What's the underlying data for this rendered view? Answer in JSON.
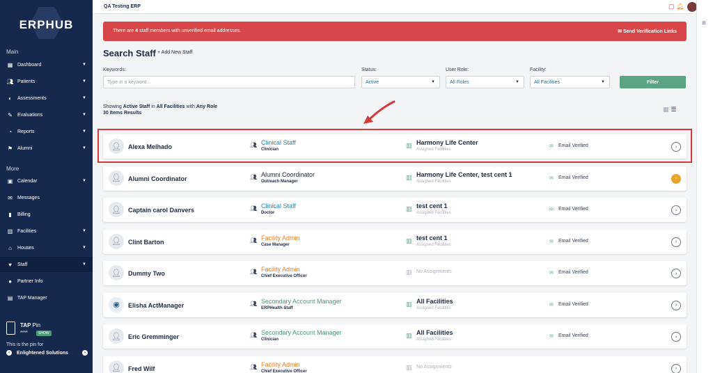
{
  "app": {
    "brand": "ERPHUB",
    "window_title": "QA Testing ERP"
  },
  "sidebar": {
    "main_label": "Main",
    "more_label": "More",
    "main_items": [
      {
        "label": "Dashboard",
        "icon": "dashboard-icon",
        "chevron": true
      },
      {
        "label": "Patients",
        "icon": "patients-icon",
        "chevron": true
      },
      {
        "label": "Assessments",
        "icon": "assessments-icon",
        "chevron": true
      },
      {
        "label": "Evaluations",
        "icon": "evaluations-icon",
        "chevron": true
      },
      {
        "label": "Reports",
        "icon": "reports-icon",
        "chevron": true
      },
      {
        "label": "Alumni",
        "icon": "alumni-icon",
        "chevron": true
      }
    ],
    "more_items": [
      {
        "label": "Calendar",
        "icon": "calendar-icon",
        "chevron": true
      },
      {
        "label": "Messages",
        "icon": "messages-icon",
        "chevron": false
      },
      {
        "label": "Billing",
        "icon": "billing-icon",
        "chevron": false
      },
      {
        "label": "Facilities",
        "icon": "facilities-icon",
        "chevron": true
      },
      {
        "label": "Houses",
        "icon": "houses-icon",
        "chevron": true
      },
      {
        "label": "Staff",
        "icon": "staff-icon",
        "chevron": true,
        "active": true
      },
      {
        "label": "Partner Info",
        "icon": "partner-info-icon",
        "chevron": false
      },
      {
        "label": "TAP Manager",
        "icon": "tap-manager-icon",
        "chevron": false
      }
    ],
    "tap": {
      "title": "TAP",
      "title_suffix": "Pin",
      "pin": "****",
      "show_label": "SHOW",
      "for_text": "This is the pin for",
      "org": "Enlightened Solutions"
    }
  },
  "alert": {
    "prefix": "There are ",
    "count": "4",
    "suffix": " staff members with unverified email addresses.",
    "action": "Send Verification Links"
  },
  "search": {
    "title": "Search Staff",
    "add_label": "+ Add New Staff",
    "keywords_label": "Keywords:",
    "keywords_placeholder": "Type in a keyword...",
    "status_label": "Status:",
    "status_value": "Active",
    "role_label": "User Role:",
    "role_value": "All Roles",
    "facility_label": "Facility:",
    "facility_value": "All Facilities",
    "filter_label": "Filter"
  },
  "results": {
    "showing_prefix": "Showing ",
    "status": "Active Staff",
    "in_text": " in ",
    "facilities": "All Facilities",
    "with_text": " with ",
    "role": "Any Role",
    "count_text": "30 Items Results"
  },
  "staff": [
    {
      "name": "Alexa Melhado",
      "role": "Clinical Staff",
      "role_color": "blue",
      "title": "Clinician",
      "facility": "Harmony Life Center",
      "facility_sub": "Assigned Facilities",
      "email": "Email Verified",
      "avatar": "person"
    },
    {
      "name": "Alumni Coordinator",
      "role": "Alumni Coordinator",
      "role_color": "dark",
      "title": "Outreach Manager",
      "facility": "Harmony Life Center, test cent 1",
      "facility_sub": "Assigned Facilities",
      "email": "Email Verified",
      "avatar": "person",
      "alt": true
    },
    {
      "name": "Captain carol Danvers",
      "role": "Clinical Staff",
      "role_color": "blue",
      "title": "Doctor",
      "facility": "test cent 1",
      "facility_sub": "Assigned Facilities",
      "email": "Email Verified",
      "avatar": "person"
    },
    {
      "name": "Clint Barton",
      "role": "Facility Admin",
      "role_color": "orange",
      "title": "Case Manager",
      "facility": "test cent 1",
      "facility_sub": "Assigned Facilities",
      "email": "Email Verified",
      "avatar": "person"
    },
    {
      "name": "Dummy Two",
      "role": "Facility Admin",
      "role_color": "orange",
      "title": "Chief Executive Officer",
      "facility": "No Assignments",
      "facility_sub": "",
      "email": "Email Verified",
      "avatar": "person",
      "none": true
    },
    {
      "name": "Elisha ActManager",
      "role": "Secondary Account Manager",
      "role_color": "green",
      "title": "ERPHealth Staff",
      "facility": "All Facilities",
      "facility_sub": "Assigned Facilities",
      "email": "Email Verified",
      "avatar": "logo"
    },
    {
      "name": "Eric Gremminger",
      "role": "Secondary Account Manager",
      "role_color": "green",
      "title": "Clinician",
      "facility": "All Facilities",
      "facility_sub": "Assigned Facilities",
      "email": "Email Verified",
      "avatar": "person"
    },
    {
      "name": "Fred Wilf",
      "role": "Facility Admin",
      "role_color": "orange",
      "title": "Chief Executive Officer",
      "facility": "No Assignments",
      "facility_sub": "",
      "email": "",
      "avatar": "person",
      "none": true
    }
  ],
  "colors": {
    "sidebar": "#14294b",
    "alert": "#d9464a",
    "accent_green": "#5ba585",
    "highlight": "#d33a3d"
  }
}
